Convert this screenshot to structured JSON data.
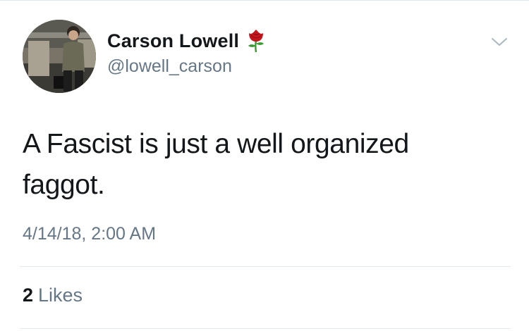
{
  "user": {
    "display_name": "Carson Lowell",
    "handle": "@lowell_carson",
    "badge_icon": "rose-icon"
  },
  "tweet": {
    "text": "A Fascist is just a well organized faggot.",
    "timestamp": "4/14/18, 2:00 AM"
  },
  "stats": {
    "likes_count": "2",
    "likes_label": "Likes"
  },
  "menu": {
    "icon": "chevron-down-icon"
  },
  "colors": {
    "primary_text": "#14171a",
    "secondary_text": "#657786",
    "divider": "#e1e8ed",
    "rose": "#c4161c",
    "stem": "#3a9a2f"
  }
}
